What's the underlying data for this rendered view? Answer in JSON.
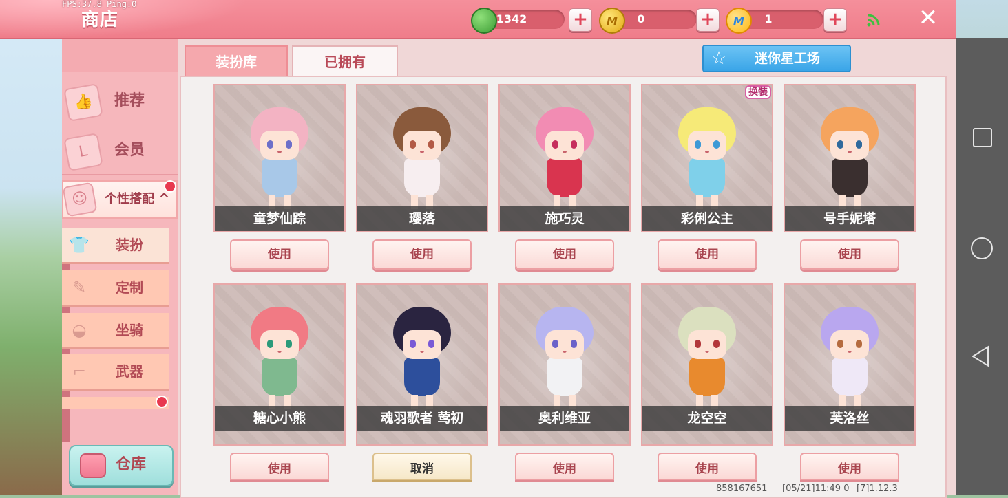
{
  "debug": {
    "fps_text": "FPS:37.8  Ping:0"
  },
  "header": {
    "title": "商店",
    "currencies": [
      {
        "icon": "green-gem-icon",
        "glyph": "",
        "value": "1342"
      },
      {
        "icon": "gold-m-coin-icon",
        "glyph": "M",
        "value": "0"
      },
      {
        "icon": "mini-coin-icon",
        "glyph": "M",
        "value": "1"
      }
    ],
    "plus_glyph": "+",
    "close_glyph": "✕"
  },
  "sidebar": {
    "items": [
      {
        "label": "推荐",
        "icon": "thumbs-up-icon"
      },
      {
        "label": "会员",
        "icon": "vip-card-icon"
      }
    ],
    "expand": {
      "label": "个性搭配",
      "icon": "mask-icon",
      "chevron": "^"
    },
    "sub_items": [
      {
        "label": "装扮",
        "icon": "shirt-icon"
      },
      {
        "label": "定制",
        "icon": "brush-icon"
      },
      {
        "label": "坐骑",
        "icon": "saddle-icon"
      },
      {
        "label": "武器",
        "icon": "gun-icon"
      }
    ],
    "warehouse": {
      "label": "仓库",
      "icon": "box-icon"
    }
  },
  "tabs": [
    {
      "label": "装扮库"
    },
    {
      "label": "已拥有"
    }
  ],
  "workshop": {
    "label": "迷你星工场",
    "icon": "star-icon"
  },
  "cards": [
    {
      "name": "童梦仙踪",
      "button": "使用",
      "hair": "#f3b3c3",
      "outfit": "#a8c8e8",
      "eye": "#6c6fc9"
    },
    {
      "name": "璎落",
      "button": "使用",
      "hair": "#8a5a3c",
      "outfit": "#f7eef0",
      "eye": "#b35a46"
    },
    {
      "name": "施巧灵",
      "button": "使用",
      "hair": "#f28cb3",
      "outfit": "#d9344f",
      "eye": "#c62e5d"
    },
    {
      "name": "彩俐公主",
      "button": "使用",
      "hair": "#f6ea78",
      "outfit": "#7fd0ea",
      "eye": "#3e9ad6"
    },
    {
      "name": "号手妮塔",
      "button": "使用",
      "hair": "#f5a45e",
      "outfit": "#3a2f2f",
      "eye": "#2f6a9d"
    },
    {
      "name": "糖心小熊",
      "button": "使用",
      "hair": "#f17a84",
      "outfit": "#7fb98f",
      "eye": "#2b9a7a"
    },
    {
      "name": "魂羽歌者 莺初",
      "button": "取消",
      "hair": "#2a2440",
      "outfit": "#2d4f9c",
      "eye": "#7a5ad6"
    },
    {
      "name": "奥利维亚",
      "button": "使用",
      "hair": "#b7b5f0",
      "outfit": "#f2f2f4",
      "eye": "#6b62c9"
    },
    {
      "name": "龙空空",
      "button": "使用",
      "hair": "#dbe0bf",
      "outfit": "#e88a2e",
      "eye": "#b2373b"
    },
    {
      "name": "芙洛丝",
      "button": "使用",
      "hair": "#b9a7ef",
      "outfit": "#efe8f7",
      "eye": "#b56b3f"
    }
  ],
  "badges": [
    "",
    "换装"
  ],
  "footer": {
    "id": "858167651",
    "time": "[05/21]11:49 0",
    "version": "[7]1.12.3"
  },
  "colors": {
    "accent": "#ef7d8a",
    "panel": "#f3f0ef",
    "sidebar": "#f6b7bc"
  }
}
